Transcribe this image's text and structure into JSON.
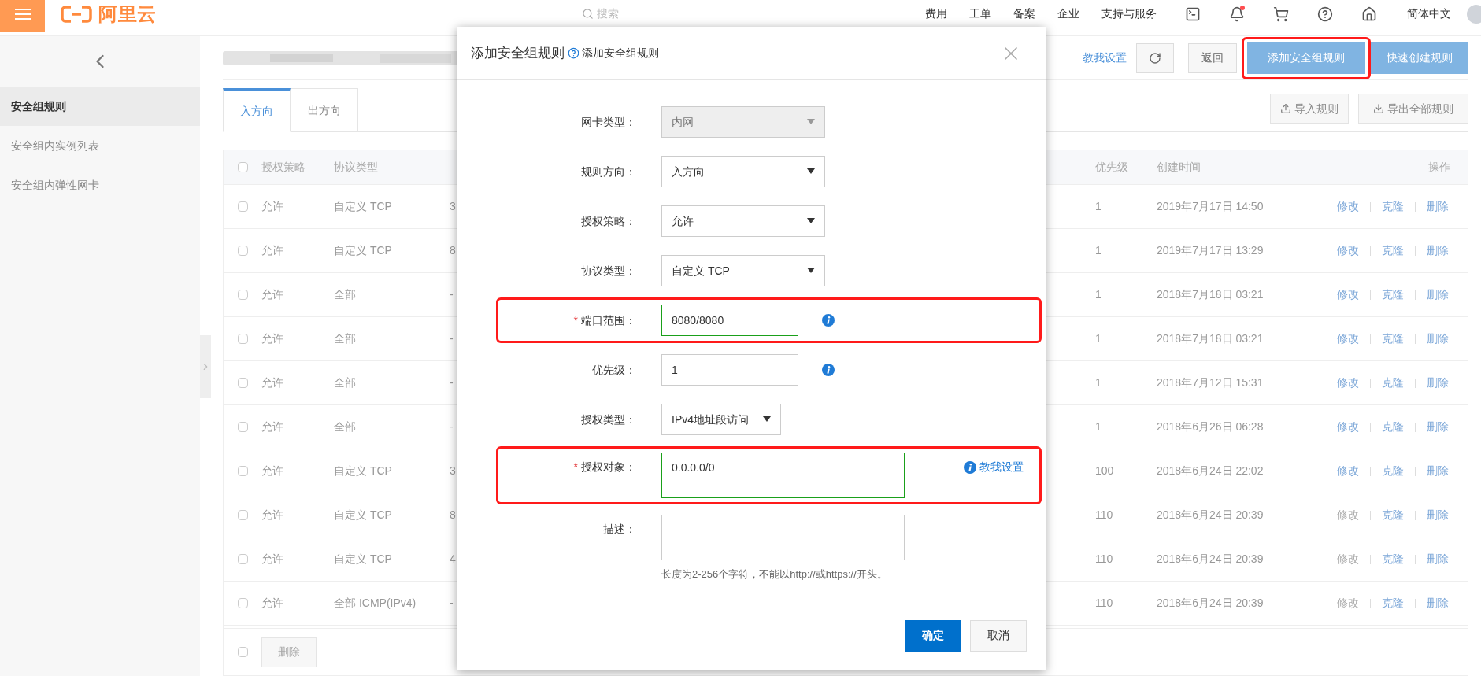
{
  "topbar": {
    "logo": "阿里云",
    "search": {
      "placeholder": "搜索"
    },
    "menu": [
      "费用",
      "工单",
      "备案",
      "企业",
      "支持与服务"
    ],
    "bell_unread": true,
    "language": "简体中文"
  },
  "sidebar": {
    "items": [
      {
        "label": "安全组规则",
        "selected": true
      },
      {
        "label": "安全组内实例列表",
        "selected": false
      },
      {
        "label": "安全组内弹性网卡",
        "selected": false
      }
    ]
  },
  "header": {
    "help_link": "教我设置",
    "back": "返回",
    "add_rule": {
      "label": "添加安全组规则",
      "highlighted": true
    },
    "quick_create": "快速创建规则"
  },
  "tabs": [
    {
      "label": "入方向",
      "selected": true
    },
    {
      "label": "出方向",
      "selected": false
    }
  ],
  "import": "导入规则",
  "export": "导出全部规则",
  "table": {
    "columns": [
      "授权策略",
      "协议类型",
      "优先级",
      "创建时间",
      "操作"
    ],
    "select_all": false,
    "rows": [
      {
        "checked": false,
        "policy": "允许",
        "protocol": "自定义 TCP",
        "column_3": "3",
        "priority": "1",
        "created": "2019年7月17日 14:50",
        "edit": "修改",
        "edit_disabled": false,
        "clone": "克隆",
        "delete": "删除"
      },
      {
        "checked": false,
        "policy": "允许",
        "protocol": "自定义 TCP",
        "column_3": "8",
        "priority": "1",
        "created": "2019年7月17日 13:29",
        "edit": "修改",
        "edit_disabled": false,
        "clone": "克隆",
        "delete": "删除"
      },
      {
        "checked": false,
        "policy": "允许",
        "protocol": "全部",
        "column_3": "-",
        "priority": "1",
        "created": "2018年7月18日 03:21",
        "edit": "修改",
        "edit_disabled": false,
        "clone": "克隆",
        "delete": "删除"
      },
      {
        "checked": false,
        "policy": "允许",
        "protocol": "全部",
        "column_3": "-",
        "priority": "1",
        "created": "2018年7月18日 03:21",
        "edit": "修改",
        "edit_disabled": false,
        "clone": "克隆",
        "delete": "删除"
      },
      {
        "checked": false,
        "policy": "允许",
        "protocol": "全部",
        "column_3": "-",
        "priority": "1",
        "created": "2018年7月12日 15:31",
        "edit": "修改",
        "edit_disabled": false,
        "clone": "克隆",
        "delete": "删除"
      },
      {
        "checked": false,
        "policy": "允许",
        "protocol": "全部",
        "column_3": "-",
        "priority": "1",
        "created": "2018年6月26日 06:28",
        "edit": "修改",
        "edit_disabled": false,
        "clone": "克隆",
        "delete": "删除"
      },
      {
        "checked": false,
        "policy": "允许",
        "protocol": "自定义 TCP",
        "column_3": "3",
        "priority": "100",
        "created": "2018年6月24日 22:02",
        "edit": "修改",
        "edit_disabled": false,
        "clone": "克隆",
        "delete": "删除"
      },
      {
        "checked": false,
        "policy": "允许",
        "protocol": "自定义 TCP",
        "column_3": "8",
        "priority": "110",
        "created": "2018年6月24日 20:39",
        "edit": "修改",
        "edit_disabled": true,
        "clone": "克隆",
        "delete": "删除"
      },
      {
        "checked": false,
        "policy": "允许",
        "protocol": "自定义 TCP",
        "column_3": "4",
        "priority": "110",
        "created": "2018年6月24日 20:39",
        "edit": "修改",
        "edit_disabled": true,
        "clone": "克隆",
        "delete": "删除"
      },
      {
        "checked": false,
        "policy": "允许",
        "protocol": "全部 ICMP(IPv4)",
        "column_3": "-",
        "priority": "110",
        "created": "2018年6月24日 20:39",
        "edit": "修改",
        "edit_disabled": true,
        "clone": "克隆",
        "delete": "删除"
      }
    ],
    "footer_checked": false,
    "footer_button": {
      "label": "删除",
      "disabled": true
    }
  },
  "dialog": {
    "title": "添加安全组规则",
    "help": "添加安全组规则",
    "fields": [
      {
        "kind": "select",
        "label": "网卡类型：",
        "value": "内网",
        "disabled": true,
        "highlighted": false,
        "info": false
      },
      {
        "kind": "select",
        "label": "规则方向：",
        "value": "入方向",
        "disabled": false,
        "highlighted": false,
        "info": false
      },
      {
        "kind": "select",
        "label": "授权策略：",
        "value": "允许",
        "disabled": false,
        "highlighted": false,
        "info": false
      },
      {
        "kind": "select",
        "label": "协议类型：",
        "value": "自定义 TCP",
        "disabled": false,
        "highlighted": false,
        "info": false
      },
      {
        "kind": "input",
        "required_mark": "*",
        "label": "端口范围：",
        "value": "8080/8080",
        "disabled": false,
        "highlighted": true,
        "info": true
      },
      {
        "kind": "input",
        "label": "优先级：",
        "value": "1",
        "disabled": false,
        "highlighted": false,
        "info": true
      },
      {
        "kind": "select_small",
        "label": "授权类型：",
        "value": "IPv4地址段访问",
        "disabled": false,
        "highlighted": false,
        "info": false
      },
      {
        "kind": "textarea",
        "required_mark": "*",
        "label": "授权对象：",
        "value": "0.0.0.0/0",
        "disabled": false,
        "highlighted": true,
        "info": false,
        "link": "教我设置"
      },
      {
        "kind": "textarea",
        "label": "描述：",
        "disabled": false,
        "highlighted": false,
        "info": false,
        "hint": "长度为2-256个字符，不能以http://或https://开头。"
      }
    ],
    "confirm": "确定",
    "cancel": "取消"
  }
}
